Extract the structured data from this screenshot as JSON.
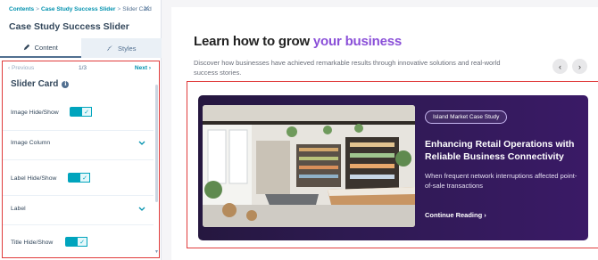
{
  "breadcrumb": {
    "items": [
      "Contents",
      "Case Study Success Slider",
      "Slider Card"
    ],
    "separator": ">"
  },
  "panel": {
    "title": "Case Study Success Slider",
    "tabs": [
      {
        "label": "Content",
        "icon": "pencil-icon"
      },
      {
        "label": "Styles",
        "icon": "brush-icon"
      }
    ],
    "pager": {
      "prev": "Previous",
      "count": "1/3",
      "next": "Next"
    },
    "card_title": "Slider Card",
    "fields": [
      {
        "label": "Image Hide/Show",
        "type": "toggle",
        "on": true
      },
      {
        "label": "Image Column",
        "type": "expander"
      },
      {
        "label": "Label Hide/Show",
        "type": "toggle",
        "on": true
      },
      {
        "label": "Label",
        "type": "expander"
      },
      {
        "label": "Title Hide/Show",
        "type": "toggle",
        "on": true
      }
    ],
    "toggle_check": "✓"
  },
  "preview": {
    "headline_main": "Learn how to grow ",
    "headline_accent": "your business",
    "subtitle": "Discover how businesses have achieved remarkable results through innovative solutions and real-world success stories.",
    "card": {
      "badge": "Island Market Case Study",
      "heading": "Enhancing Retail Operations with Reliable Business Connectivity",
      "body": "When frequent network interruptions affected point-of-sale transactions",
      "cta": "Continue Reading",
      "cta_arrow": "›"
    },
    "nav_prev": "‹",
    "nav_next": "›"
  },
  "colors": {
    "accent_purple": "#8a4fd8",
    "toggle_teal": "#00a4bd",
    "highlight_red": "#e03b3b",
    "card_bg": "#2e1a52"
  }
}
